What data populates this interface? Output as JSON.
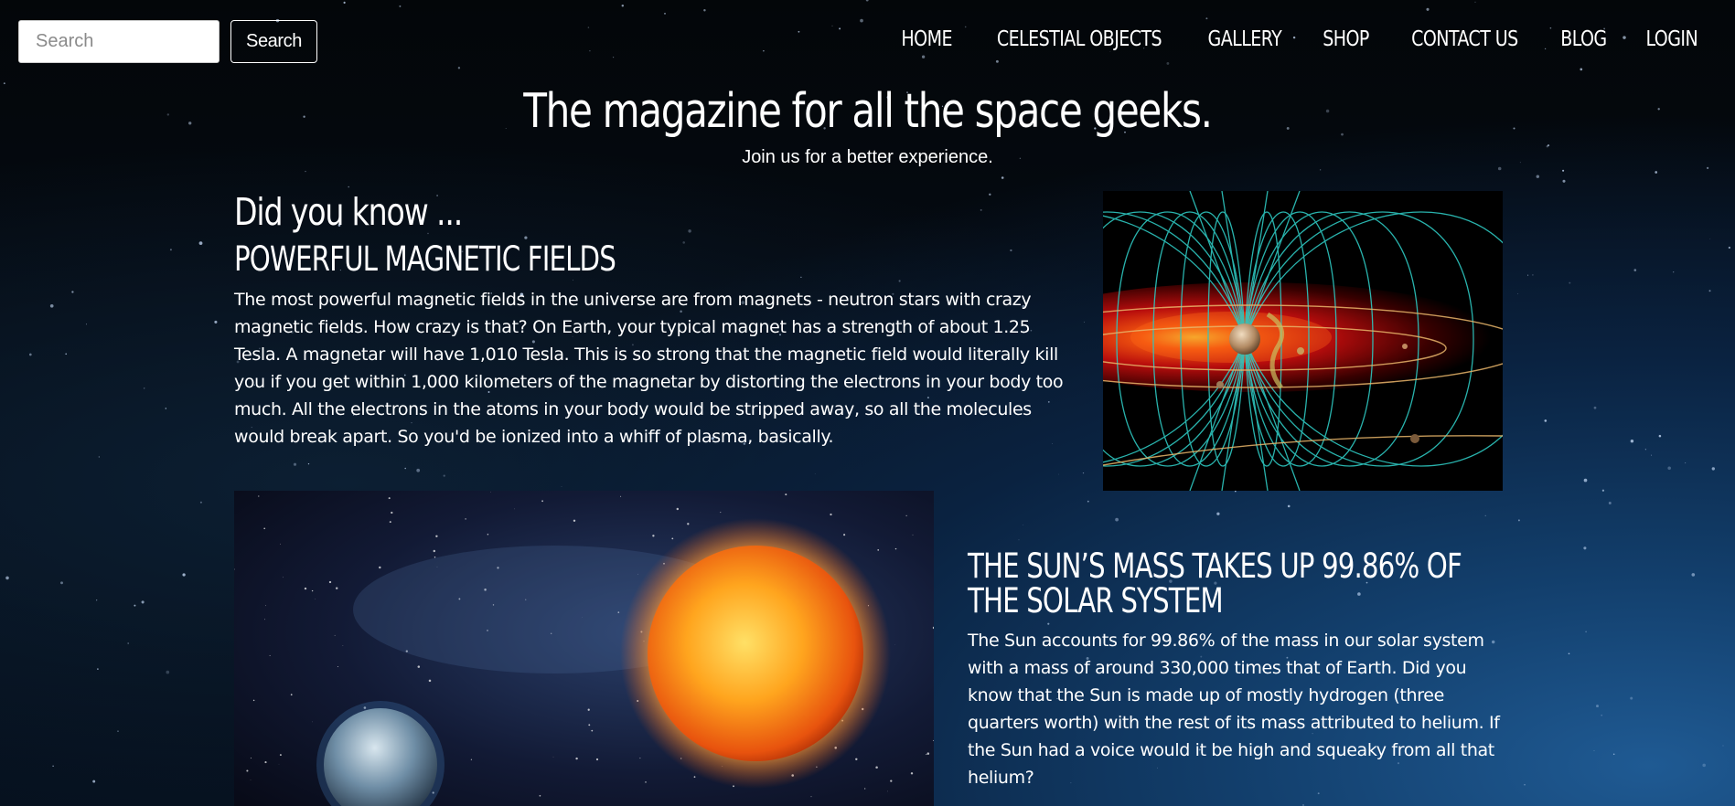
{
  "header": {
    "search_placeholder": "Search",
    "search_button": "Search",
    "nav": [
      "HOME",
      "CELESTIAL OBJECTS",
      "GALLERY",
      "SHOP",
      "CONTACT US",
      "BLOG",
      "LOGIN"
    ]
  },
  "hero": {
    "title": "The magazine for all the space geeks.",
    "subtitle": "Join us for a better experience."
  },
  "facts": {
    "intro": "Did you know ...",
    "items": [
      {
        "title": "POWERFUL MAGNETIC FIELDS",
        "body": "The most powerful magnetic fields in the universe are from magnets - neutron stars with crazy magnetic fields. How crazy is that? On Earth, your typical magnet has a strength of about 1.25 Tesla. A magnetar will have 1,010 Tesla. This is so strong that the magnetic field would literally kill you if you get within 1,000 kilometers of the magnetar by distorting the electrons in your body too much. All the electrons in the atoms in your body would be stripped away, so all the molecules would break apart. So you'd be ionized into a whiff of plasma, basically."
      },
      {
        "title": "THE SUN’S MASS TAKES UP 99.86% OF THE SOLAR SYSTEM",
        "body": "The Sun accounts for 99.86% of the mass in our solar system with a mass of around 330,000 times that of Earth. Did you know that the Sun is made up of mostly hydrogen (three quarters worth) with the rest of its mass attributed to helium. If the Sun had a voice would it be high and squeaky from all that helium?"
      }
    ]
  },
  "colors": {
    "accent_field_lines": "#2ec7c0",
    "sun_core": "#ffb020"
  }
}
